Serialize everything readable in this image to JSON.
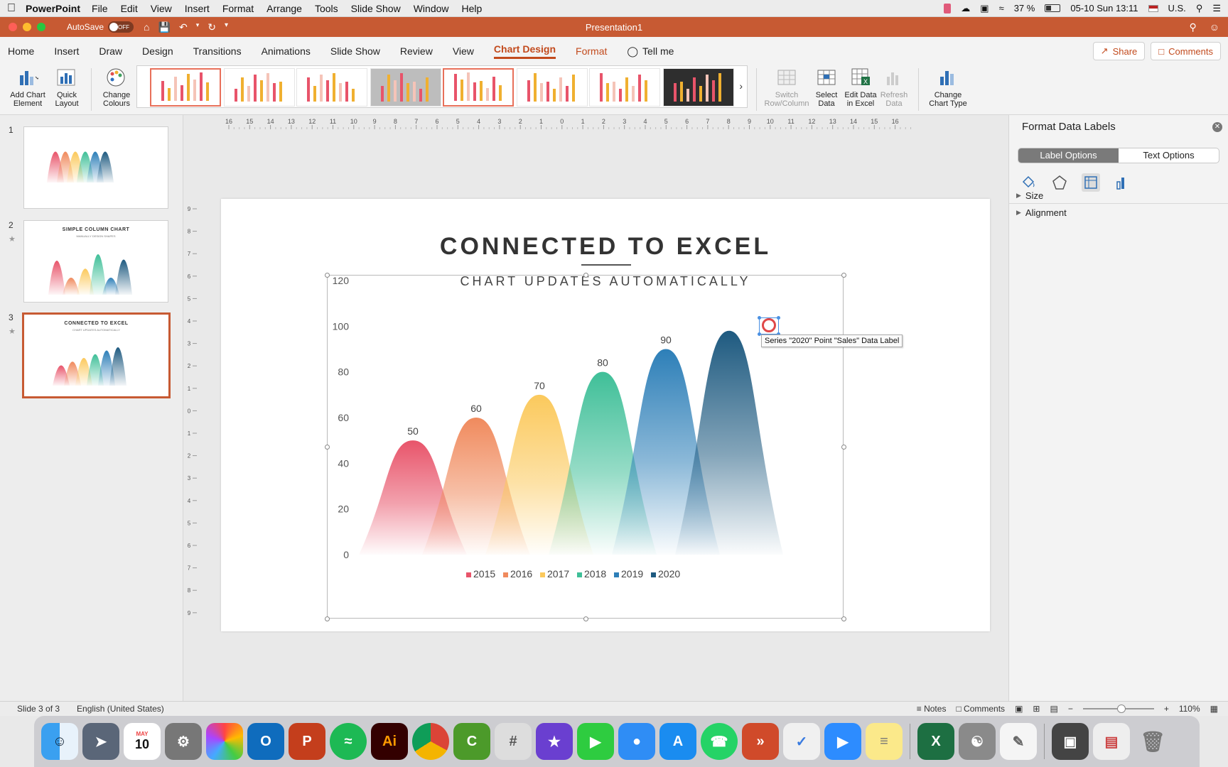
{
  "menubar": {
    "app_name": "PowerPoint",
    "items": [
      "File",
      "Edit",
      "View",
      "Insert",
      "Format",
      "Arrange",
      "Tools",
      "Slide Show",
      "Window",
      "Help"
    ],
    "battery": "37 %",
    "datetime": "05-10 Sun  13:11",
    "input_source": "U.S."
  },
  "titlebar": {
    "autosave_label": "AutoSave",
    "autosave_state": "OFF",
    "document_title": "Presentation1"
  },
  "ribbon_tabs": {
    "items": [
      "Home",
      "Insert",
      "Draw",
      "Design",
      "Transitions",
      "Animations",
      "Slide Show",
      "Review",
      "View",
      "Chart Design",
      "Format"
    ],
    "active": "Chart Design",
    "tell_me": "Tell me",
    "share": "Share",
    "comments": "Comments"
  },
  "ribbon": {
    "add_chart_element": "Add Chart Element",
    "quick_layout": "Quick Layout",
    "change_colours": "Change Colours",
    "switch_row_column": "Switch Row/Column",
    "select_data": "Select Data",
    "edit_data_in_excel": "Edit Data in Excel",
    "refresh_data": "Refresh Data",
    "change_chart_type": "Change Chart Type"
  },
  "slides_pane": {
    "slides": [
      {
        "number": "1"
      },
      {
        "number": "2",
        "title": "SIMPLE COLUMN CHART",
        "subtitle": "MANUALLY DESIGN SHAPES"
      },
      {
        "number": "3",
        "title": "CONNECTED TO EXCEL",
        "subtitle": "CHART UPDATES AUTOMATICALLY"
      }
    ],
    "selected": "3"
  },
  "ruler": {
    "h_labels": [
      "16",
      "15",
      "14",
      "13",
      "12",
      "11",
      "10",
      "9",
      "8",
      "7",
      "6",
      "5",
      "4",
      "3",
      "2",
      "1",
      "0",
      "1",
      "2",
      "3",
      "4",
      "5",
      "6",
      "7",
      "8",
      "9",
      "10",
      "11",
      "12",
      "13",
      "14",
      "15",
      "16"
    ],
    "v_labels": [
      "9",
      "8",
      "7",
      "6",
      "5",
      "4",
      "3",
      "2",
      "1",
      "0",
      "1",
      "2",
      "3",
      "4",
      "5",
      "6",
      "7",
      "8",
      "9"
    ]
  },
  "slide": {
    "title": "CONNECTED TO EXCEL",
    "subtitle": "CHART UPDATES AUTOMATICALLY",
    "tooltip": "Series \"2020\" Point \"Sales\" Data Label"
  },
  "chart_data": {
    "type": "area",
    "series": [
      {
        "name": "2015",
        "values": [
          50
        ],
        "color": "#e8546a"
      },
      {
        "name": "2016",
        "values": [
          60
        ],
        "color": "#f08a5d"
      },
      {
        "name": "2017",
        "values": [
          70
        ],
        "color": "#fbc95c"
      },
      {
        "name": "2018",
        "values": [
          80
        ],
        "color": "#3fbf98"
      },
      {
        "name": "2019",
        "values": [
          90
        ],
        "color": "#2d7fb8"
      },
      {
        "name": "2020",
        "values": [
          98
        ],
        "color": "#1e5a80"
      }
    ],
    "data_labels": [
      "50",
      "60",
      "70",
      "80",
      "90",
      ""
    ],
    "y_ticks": [
      "0",
      "20",
      "40",
      "60",
      "80",
      "100",
      "120"
    ],
    "ylim": [
      0,
      120
    ],
    "legend_position": "bottom",
    "grid": false
  },
  "format_pane": {
    "title": "Format Data Labels",
    "tab_label_options": "Label Options",
    "tab_text_options": "Text Options",
    "sections": [
      "Size",
      "Alignment"
    ],
    "icons": [
      "fill-bucket-icon",
      "pentagon-effects-icon",
      "size-properties-icon",
      "bar-chart-options-icon"
    ]
  },
  "statusbar": {
    "slide_info": "Slide 3 of 3",
    "language": "English (United States)",
    "notes": "Notes",
    "comments": "Comments",
    "zoom": "110%"
  },
  "dock": {
    "calendar_month": "MAY",
    "calendar_day": "10"
  }
}
